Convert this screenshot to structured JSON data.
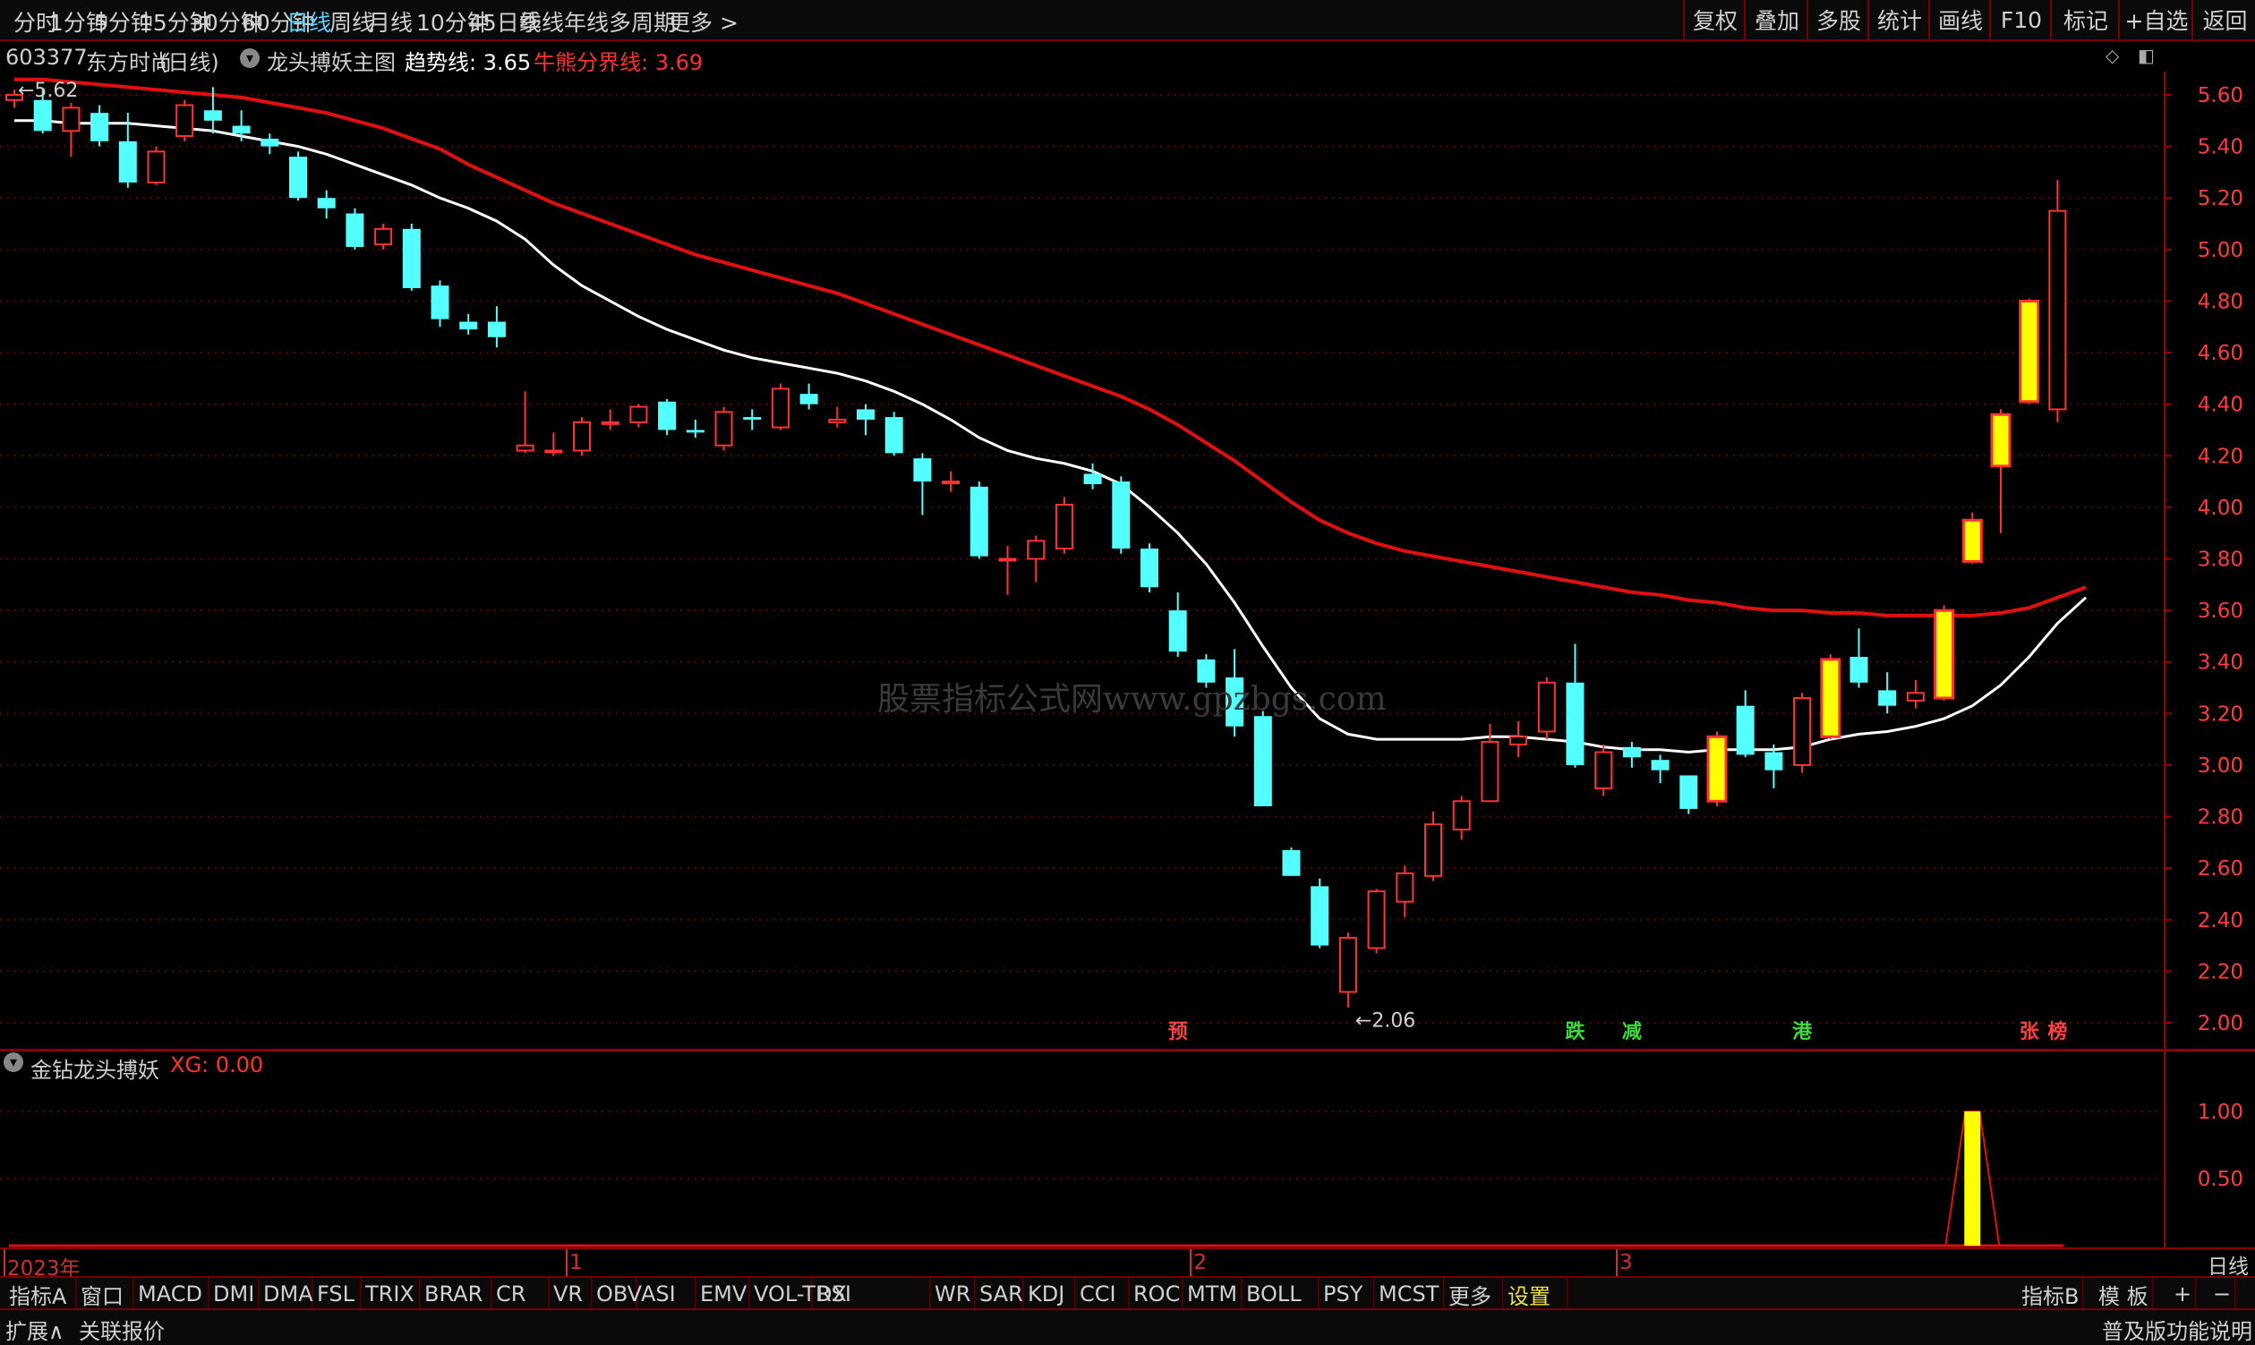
{
  "periods": [
    "分时",
    "1分钟",
    "5分钟",
    "15分钟",
    "30分钟",
    "60分钟",
    "日线",
    "周线",
    "月线",
    "10分钟",
    "45日线",
    "季线",
    "年线",
    "多周期",
    "更多 >"
  ],
  "active_period": "日线",
  "right_tools": [
    "复权",
    "叠加",
    "多股",
    "统计",
    "画线",
    "F10",
    "标记",
    "+自选",
    "返回"
  ],
  "stock": {
    "code": "603377",
    "name": "东方时尚",
    "period_label": "(日线)"
  },
  "main_indicator": {
    "name": "龙头搏妖主图",
    "trend_label": "趋势线: 3.65",
    "bull_label": "牛熊分界线: 3.69"
  },
  "sub_indicator": {
    "name": "金钻龙头搏妖",
    "xg_label": "XG: 0.00"
  },
  "colors": {
    "up": "#ff3232",
    "down": "#54ffff",
    "trend": "#ffffff",
    "bull": "#e01010",
    "signal_fill": "#ffff00",
    "grid": "#7a0000",
    "axis_text": "#ff3c3c"
  },
  "chart_data": [
    {
      "type": "candlestick",
      "title": "",
      "ylim": [
        1.98,
        5.68
      ],
      "yticks": [
        2.0,
        2.2,
        2.4,
        2.6,
        2.8,
        3.0,
        3.2,
        3.4,
        3.6,
        3.8,
        4.0,
        4.2,
        4.4,
        4.6,
        4.8,
        5.0,
        5.2,
        5.4,
        5.6
      ],
      "ytick_labels": [
        "2.00",
        "2.20",
        "2.40",
        "2.60",
        "2.80",
        "3.00",
        "3.20",
        "3.40",
        "3.60",
        "3.80",
        "4.00",
        "4.20",
        "4.40",
        "4.60",
        "4.80",
        "5.00",
        "5.20",
        "5.40",
        "5.60"
      ],
      "x_labels": [
        {
          "i": 0,
          "text": "2023年"
        },
        {
          "i": 20,
          "text": "1"
        },
        {
          "i": 42,
          "text": "2"
        },
        {
          "i": 57,
          "text": "3"
        }
      ],
      "candles": [
        [
          5.58,
          5.6,
          5.62,
          5.55
        ],
        [
          5.58,
          5.46,
          5.62,
          5.45
        ],
        [
          5.46,
          5.55,
          5.57,
          5.36
        ],
        [
          5.53,
          5.42,
          5.56,
          5.4
        ],
        [
          5.42,
          5.26,
          5.53,
          5.24
        ],
        [
          5.26,
          5.38,
          5.4,
          5.25
        ],
        [
          5.44,
          5.56,
          5.58,
          5.42
        ],
        [
          5.54,
          5.5,
          5.63,
          5.45
        ],
        [
          5.48,
          5.45,
          5.54,
          5.42
        ],
        [
          5.43,
          5.4,
          5.45,
          5.37
        ],
        [
          5.36,
          5.2,
          5.38,
          5.19
        ],
        [
          5.2,
          5.16,
          5.23,
          5.12
        ],
        [
          5.14,
          5.01,
          5.16,
          5.0
        ],
        [
          5.02,
          5.08,
          5.1,
          5.0
        ],
        [
          5.08,
          4.85,
          5.1,
          4.84
        ],
        [
          4.86,
          4.73,
          4.88,
          4.7
        ],
        [
          4.72,
          4.69,
          4.75,
          4.67
        ],
        [
          4.72,
          4.66,
          4.78,
          4.62
        ],
        [
          4.22,
          4.24,
          4.45,
          4.21
        ],
        [
          4.22,
          4.22,
          4.29,
          4.2
        ],
        [
          4.22,
          4.33,
          4.35,
          4.2
        ],
        [
          4.33,
          4.33,
          4.38,
          4.3
        ],
        [
          4.33,
          4.39,
          4.4,
          4.31
        ],
        [
          4.41,
          4.3,
          4.42,
          4.28
        ],
        [
          4.3,
          4.29,
          4.34,
          4.27
        ],
        [
          4.24,
          4.37,
          4.39,
          4.22
        ],
        [
          4.35,
          4.34,
          4.38,
          4.3
        ],
        [
          4.31,
          4.46,
          4.48,
          4.3
        ],
        [
          4.44,
          4.4,
          4.48,
          4.38
        ],
        [
          4.33,
          4.34,
          4.39,
          4.31
        ],
        [
          4.38,
          4.34,
          4.4,
          4.28
        ],
        [
          4.35,
          4.21,
          4.37,
          4.2
        ],
        [
          4.19,
          4.1,
          4.21,
          3.97
        ],
        [
          4.1,
          4.1,
          4.14,
          4.06
        ],
        [
          4.08,
          3.81,
          4.1,
          3.8
        ],
        [
          3.8,
          3.8,
          3.85,
          3.66
        ],
        [
          3.8,
          3.87,
          3.89,
          3.71
        ],
        [
          3.84,
          4.01,
          4.04,
          3.82
        ],
        [
          4.13,
          4.09,
          4.17,
          4.07
        ],
        [
          4.1,
          3.84,
          4.12,
          3.82
        ],
        [
          3.84,
          3.69,
          3.86,
          3.67
        ],
        [
          3.6,
          3.44,
          3.67,
          3.42
        ],
        [
          3.41,
          3.32,
          3.43,
          3.3
        ],
        [
          3.34,
          3.15,
          3.45,
          3.11
        ],
        [
          3.19,
          2.84,
          3.21,
          2.84
        ],
        [
          2.67,
          2.57,
          2.68,
          2.57
        ],
        [
          2.53,
          2.3,
          2.56,
          2.29
        ],
        [
          2.12,
          2.33,
          2.35,
          2.06
        ],
        [
          2.29,
          2.51,
          2.52,
          2.27
        ],
        [
          2.47,
          2.58,
          2.61,
          2.41
        ],
        [
          2.57,
          2.77,
          2.82,
          2.55
        ],
        [
          2.75,
          2.86,
          2.88,
          2.71
        ],
        [
          2.86,
          3.09,
          3.16,
          2.86
        ],
        [
          3.08,
          3.11,
          3.17,
          3.03
        ],
        [
          3.13,
          3.32,
          3.34,
          3.1
        ],
        [
          3.32,
          3.0,
          3.47,
          2.99
        ],
        [
          2.91,
          3.05,
          3.08,
          2.88
        ],
        [
          3.07,
          3.03,
          3.09,
          2.99
        ],
        [
          3.02,
          2.98,
          3.04,
          2.93
        ],
        [
          2.96,
          2.83,
          2.96,
          2.81
        ],
        [
          2.86,
          3.11,
          3.13,
          2.84
        ],
        [
          3.23,
          3.04,
          3.29,
          3.03
        ],
        [
          3.05,
          2.98,
          3.08,
          2.91
        ],
        [
          3.0,
          3.26,
          3.28,
          2.97
        ],
        [
          3.11,
          3.41,
          3.43,
          3.1
        ],
        [
          3.42,
          3.32,
          3.53,
          3.3
        ],
        [
          3.29,
          3.23,
          3.36,
          3.2
        ],
        [
          3.25,
          3.28,
          3.33,
          3.22
        ],
        [
          3.26,
          3.6,
          3.62,
          3.25
        ],
        [
          3.79,
          3.95,
          3.98,
          3.78
        ],
        [
          4.16,
          4.36,
          4.38,
          3.9
        ],
        [
          4.41,
          4.8,
          4.81,
          4.4
        ],
        [
          4.38,
          5.15,
          5.27,
          4.33
        ]
      ],
      "highlighted": [
        60,
        64,
        68,
        69,
        70,
        71
      ],
      "trend_line": [
        5.5,
        5.5,
        5.49,
        5.49,
        5.49,
        5.48,
        5.47,
        5.46,
        5.44,
        5.42,
        5.4,
        5.37,
        5.33,
        5.29,
        5.25,
        5.2,
        5.16,
        5.11,
        5.04,
        4.94,
        4.86,
        4.8,
        4.74,
        4.69,
        4.65,
        4.61,
        4.58,
        4.56,
        4.54,
        4.52,
        4.49,
        4.45,
        4.4,
        4.34,
        4.27,
        4.22,
        4.19,
        4.17,
        4.14,
        4.09,
        4.0,
        3.9,
        3.78,
        3.63,
        3.46,
        3.3,
        3.18,
        3.12,
        3.1,
        3.1,
        3.1,
        3.1,
        3.11,
        3.11,
        3.1,
        3.09,
        3.07,
        3.06,
        3.06,
        3.05,
        3.06,
        3.06,
        3.06,
        3.07,
        3.1,
        3.12,
        3.13,
        3.15,
        3.18,
        3.23,
        3.31,
        3.42,
        3.55,
        3.65
      ],
      "bull_line": [
        5.66,
        5.66,
        5.65,
        5.64,
        5.63,
        5.62,
        5.61,
        5.6,
        5.59,
        5.57,
        5.55,
        5.53,
        5.5,
        5.47,
        5.43,
        5.39,
        5.33,
        5.28,
        5.23,
        5.18,
        5.14,
        5.1,
        5.06,
        5.02,
        4.98,
        4.95,
        4.92,
        4.89,
        4.86,
        4.83,
        4.79,
        4.75,
        4.71,
        4.67,
        4.63,
        4.59,
        4.55,
        4.51,
        4.47,
        4.43,
        4.38,
        4.32,
        4.25,
        4.18,
        4.1,
        4.02,
        3.95,
        3.9,
        3.86,
        3.83,
        3.81,
        3.79,
        3.77,
        3.75,
        3.73,
        3.71,
        3.69,
        3.67,
        3.66,
        3.64,
        3.63,
        3.61,
        3.6,
        3.6,
        3.59,
        3.59,
        3.58,
        3.58,
        3.58,
        3.58,
        3.59,
        3.61,
        3.65,
        3.69
      ],
      "low_marker": {
        "i": 47,
        "text": "←2.06"
      },
      "high_marker": {
        "i": 0,
        "text": "←5.62"
      },
      "signals": [
        {
          "i": 41,
          "text": "预",
          "color": "#ff4040"
        },
        {
          "i": 55,
          "text": "跌",
          "color": "#3cdc3c"
        },
        {
          "i": 57,
          "text": "减",
          "color": "#3cdc3c"
        },
        {
          "i": 63,
          "text": "港",
          "color": "#3cdc3c"
        },
        {
          "i": 71,
          "text": "张",
          "color": "#ff4040"
        },
        {
          "i": 72,
          "text": "榜",
          "color": "#ff4040"
        }
      ]
    },
    {
      "type": "bar",
      "title": "",
      "ylim": [
        0,
        1.25
      ],
      "yticks": [
        0.5,
        1.0
      ],
      "ytick_labels": [
        "0.50",
        "1.00"
      ],
      "spike_index": 69,
      "spike_value": 1.0,
      "values_note": ""
    }
  ],
  "watermark": "股票指标公式网www.gpzbgs.com",
  "x_period_label": "日线",
  "bottom_tabs": [
    "指标A",
    "窗口",
    "MACD",
    "DMI",
    "DMA",
    "FSL",
    "TRIX",
    "BRAR",
    "CR",
    "VR",
    "OBV",
    "ASI",
    "EMV",
    "VOL-TDX",
    "RSI",
    "WR",
    "SAR",
    "KDJ",
    "CCI",
    "ROC",
    "MTM",
    "BOLL",
    "PSY",
    "MCST",
    "更多",
    "设置"
  ],
  "bottom_active": "设置",
  "bottom_right": [
    "指标B",
    "模 板",
    "+",
    "−"
  ],
  "status_left": [
    "扩展∧",
    "关联报价"
  ],
  "status_right": "普及版功能说明"
}
